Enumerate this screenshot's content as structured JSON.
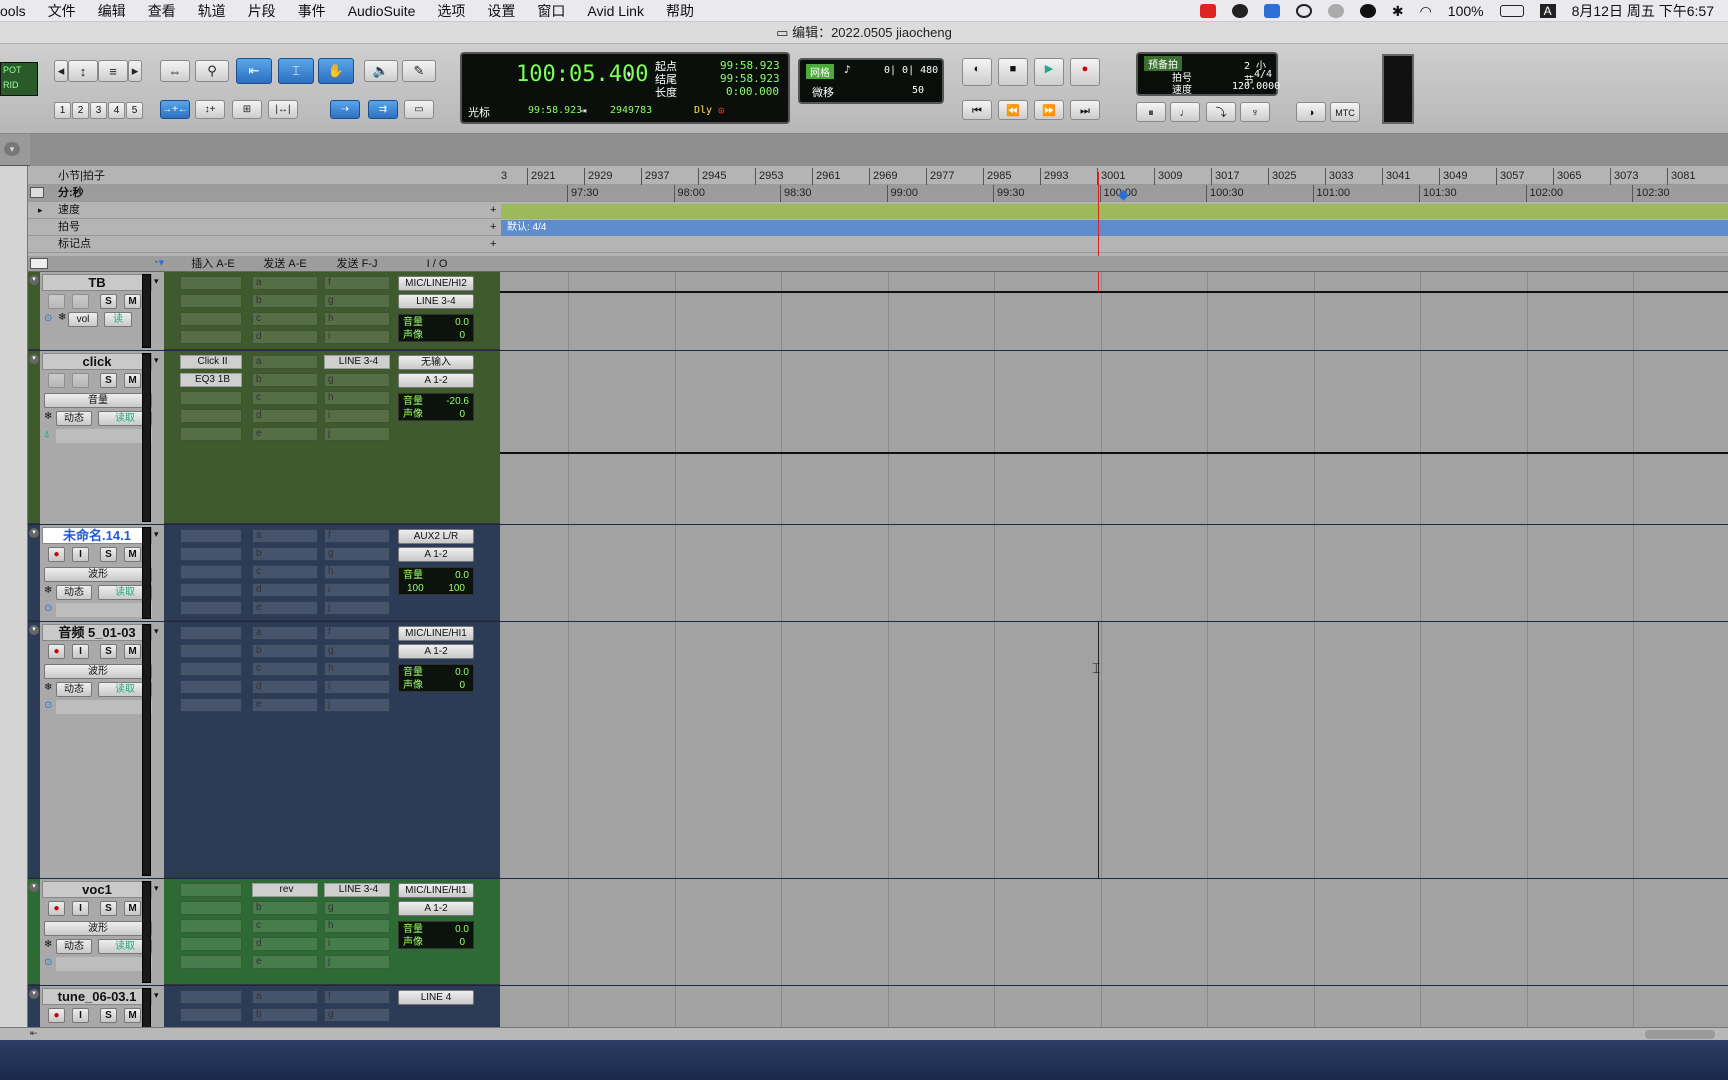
{
  "menubar": {
    "items": [
      "ools",
      "文件",
      "编辑",
      "查看",
      "轨道",
      "片段",
      "事件",
      "AudioSuite",
      "选项",
      "设置",
      "窗口",
      "Avid Link",
      "帮助"
    ],
    "battery": "100%",
    "datetime": "8月12日 周五 下午6:57",
    "input_method": "A"
  },
  "window": {
    "title": "编辑：2022.0505 jiaocheng"
  },
  "toolbar": {
    "badge_left": [
      "POT",
      "RID"
    ],
    "zoom_presets": [
      "1",
      "2",
      "3",
      "4",
      "5"
    ],
    "counter": {
      "main": "100:05.400",
      "cursor_label": "光标",
      "cursor_value": "99:58.923",
      "samples": "2949783",
      "dly_label": "Dly",
      "start_label": "起点",
      "start_value": "99:58.923",
      "end_label": "结尾",
      "end_value": "99:58.923",
      "length_label": "长度",
      "length_value": "0:00.000"
    },
    "grid": {
      "grid_label": "网格",
      "grid_value": "0| 0| 480",
      "nudge_label": "微移",
      "nudge_value": "50"
    },
    "transport_info": {
      "preroll_label": "预备拍",
      "preroll_value": "2 小节",
      "meter_label": "拍号",
      "meter_value": "4/4",
      "tempo_label": "速度",
      "tempo_value": "120.0000"
    },
    "mtc": "MTC"
  },
  "rulers": {
    "bars_label": "小节|拍子",
    "minsec_label": "分:秒",
    "tempo_label": "速度",
    "meter_label": "拍号",
    "markers_label": "标记点",
    "bars": [
      "3",
      "2921",
      "2929",
      "2937",
      "2945",
      "2953",
      "2961",
      "2969",
      "2977",
      "2985",
      "2993",
      "3001",
      "3009",
      "3017",
      "3025",
      "3033",
      "3041",
      "3049",
      "3057",
      "3065",
      "3073",
      "3081"
    ],
    "times": [
      "97:30",
      "98:00",
      "98:30",
      "99:00",
      "99:30",
      "100:00",
      "100:30",
      "101:00",
      "101:30",
      "102:00",
      "102:30"
    ],
    "meter_text": "默认: 4/4"
  },
  "columns": {
    "inserts": "插入 A-E",
    "sends_ae": "发送 A-E",
    "sends_fj": "发送 F-J",
    "io": "I / O"
  },
  "tracks": [
    {
      "name": "TB",
      "io_in": "MIC/LINE/HI2",
      "io_out": "LINE 3-4",
      "vol_label": "音量",
      "vol": "0.0",
      "pan_label": "声像",
      "pan": "0",
      "mode": "vol",
      "auto": "读"
    },
    {
      "name": "click",
      "inserts": [
        "Click II",
        "EQ3 1B"
      ],
      "send_f": "LINE 3-4",
      "io_in": "无输入",
      "io_out": "A 1-2",
      "vol_label": "音量",
      "vol": "-20.6",
      "pan_label": "声像",
      "pan": "0",
      "mode": "音量",
      "dyn": "动态",
      "auto": "读取"
    },
    {
      "name": "未命名.14.1",
      "io_in": "AUX2 L/R",
      "io_out": "A 1-2",
      "vol_label": "音量",
      "vol": "0.0",
      "pan_l": "100",
      "pan_r": "100",
      "mode": "波形",
      "dyn": "动态",
      "auto": "读取"
    },
    {
      "name": "音频 5_01-03",
      "io_in": "MIC/LINE/HI1",
      "io_out": "A 1-2",
      "vol_label": "音量",
      "vol": "0.0",
      "pan_label": "声像",
      "pan": "0",
      "mode": "波形",
      "dyn": "动态",
      "auto": "读取"
    },
    {
      "name": "voc1",
      "send_a": "rev",
      "send_f": "LINE 3-4",
      "io_in": "MIC/LINE/HI1",
      "io_out": "A 1-2",
      "vol_label": "音量",
      "vol": "0.0",
      "pan_label": "声像",
      "pan": "0",
      "mode": "波形",
      "dyn": "动态",
      "auto": "读取"
    },
    {
      "name": "tune_06-03.1",
      "io_in": "LINE 4"
    }
  ],
  "slot_letters_ae": [
    "a",
    "b",
    "c",
    "d",
    "e"
  ],
  "slot_letters_fj": [
    "f",
    "g",
    "h",
    "i",
    "j"
  ]
}
